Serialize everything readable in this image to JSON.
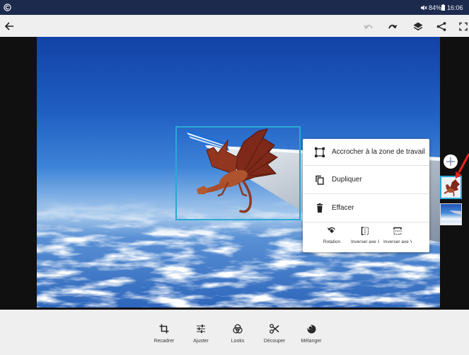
{
  "status_bar": {
    "app_icon": "app-logo-icon",
    "mute_icon": "mute-icon",
    "battery_level": "84%",
    "battery_icon": "battery-icon",
    "time": "16:06"
  },
  "toolbar": {
    "back_icon": "back-arrow-icon",
    "actions": [
      {
        "icon": "undo-icon",
        "enabled": false
      },
      {
        "icon": "redo-icon",
        "enabled": true
      },
      {
        "icon": "layers-icon",
        "enabled": true
      },
      {
        "icon": "share-icon",
        "enabled": true
      },
      {
        "icon": "fullscreen-icon",
        "enabled": true
      }
    ]
  },
  "context_menu": {
    "items": [
      {
        "label": "Accrocher à la zone de travail",
        "icon": "snap-to-artboard-icon"
      },
      {
        "label": "Dupliquer",
        "icon": "duplicate-icon"
      },
      {
        "label": "Effacer",
        "icon": "trash-icon"
      }
    ],
    "transforms": [
      {
        "label": "Rotation",
        "icon": "rotate-icon"
      },
      {
        "label": "Inverser axe X",
        "icon": "flip-x-icon"
      },
      {
        "label": "Inverser axe Y",
        "icon": "flip-y-icon"
      }
    ]
  },
  "layers_panel": {
    "add_icon": "add-layer-icon",
    "layers": [
      {
        "icon": "dragon-layer-thumbnail",
        "selected": true
      },
      {
        "icon": "sky-background-thumbnail",
        "selected": false
      }
    ]
  },
  "bottom_toolbar": {
    "tools": [
      {
        "label": "Recadrer",
        "icon": "crop-icon"
      },
      {
        "label": "Ajuster",
        "icon": "adjust-icon"
      },
      {
        "label": "Looks",
        "icon": "looks-icon"
      },
      {
        "label": "Découper",
        "icon": "cut-icon"
      },
      {
        "label": "Mélanger",
        "icon": "blend-icon"
      }
    ]
  },
  "colors": {
    "status_bar": "#1c2b4d",
    "toolbar_bg": "#efefef",
    "canvas_bg": "#101010",
    "selection_accent": "#2aa8d4",
    "annotation": "#e3241b",
    "icon": "#2b2b2b",
    "disabled_icon": "#b8b8b8"
  }
}
